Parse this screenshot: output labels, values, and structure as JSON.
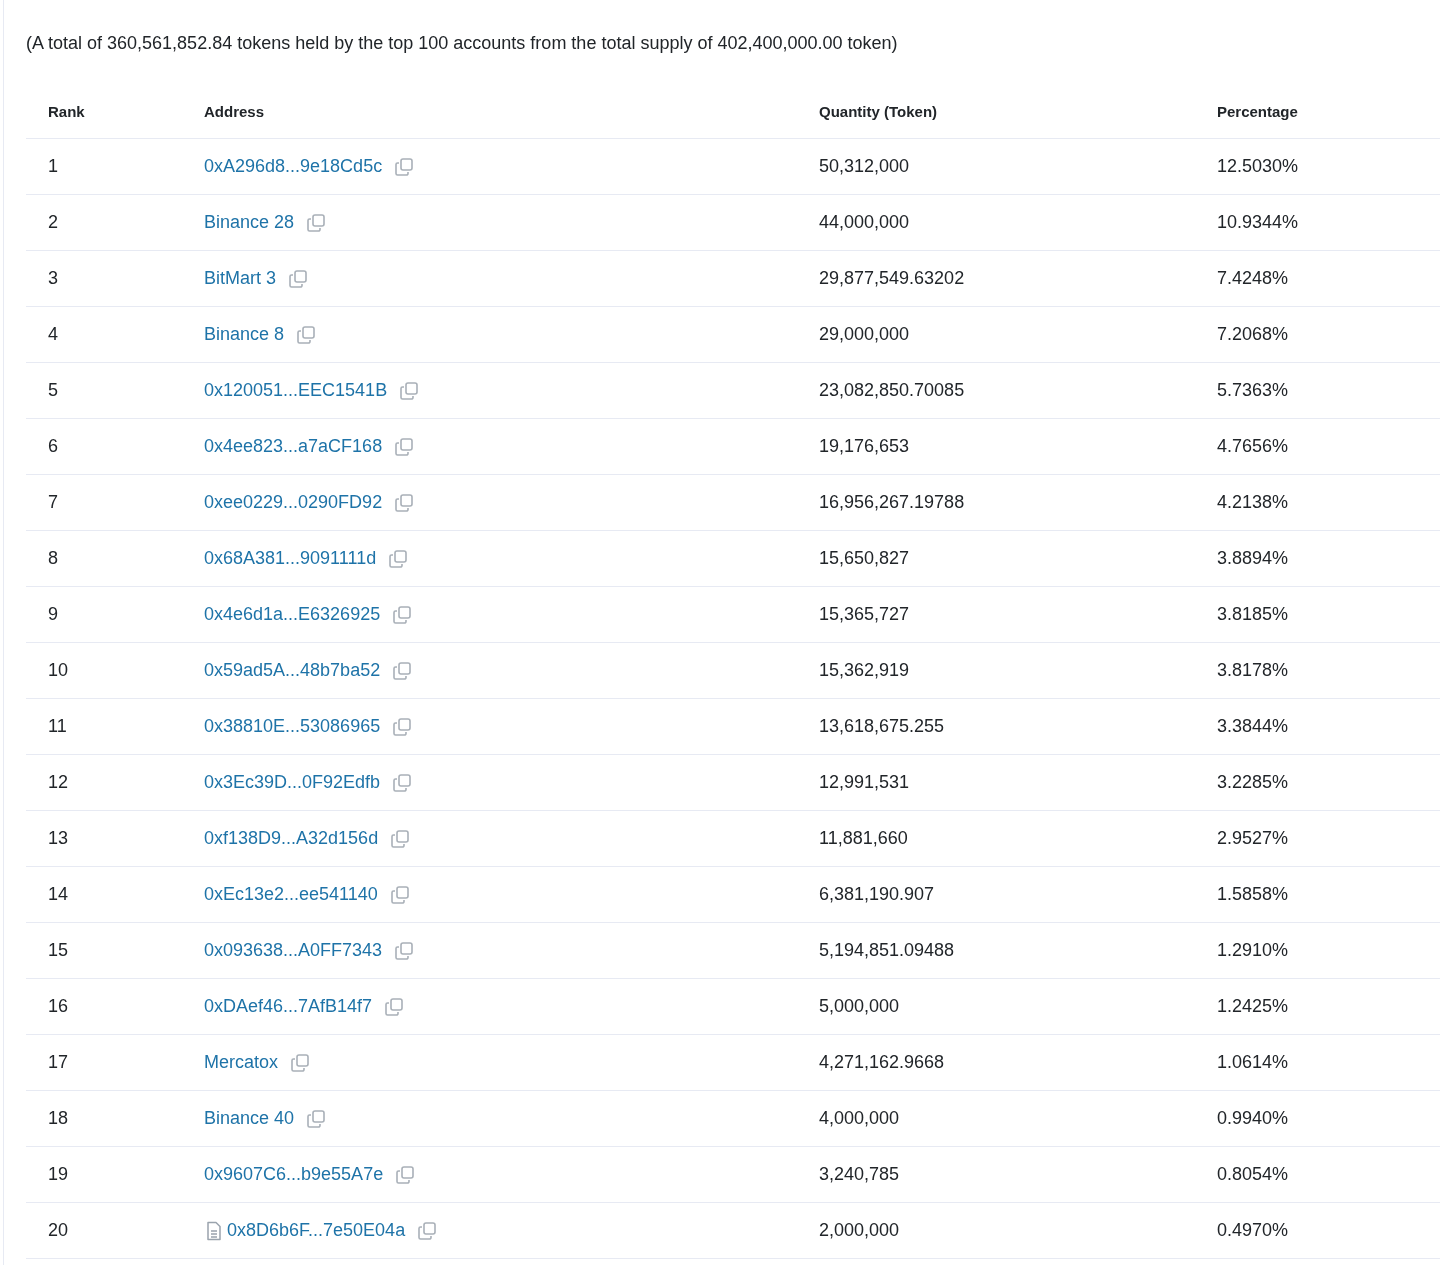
{
  "summary": "(A total of 360,561,852.84 tokens held by the top 100 accounts from the total supply of 402,400,000.00 token)",
  "table": {
    "columns": [
      "Rank",
      "Address",
      "Quantity (Token)",
      "Percentage"
    ],
    "rows": [
      {
        "rank": "1",
        "address": "0xA296d8...9e18Cd5c",
        "contract": false,
        "quantity": "50,312,000",
        "percentage": "12.5030%"
      },
      {
        "rank": "2",
        "address": "Binance 28",
        "contract": false,
        "quantity": "44,000,000",
        "percentage": "10.9344%"
      },
      {
        "rank": "3",
        "address": "BitMart 3",
        "contract": false,
        "quantity": "29,877,549.63202",
        "percentage": "7.4248%"
      },
      {
        "rank": "4",
        "address": "Binance 8",
        "contract": false,
        "quantity": "29,000,000",
        "percentage": "7.2068%"
      },
      {
        "rank": "5",
        "address": "0x120051...EEC1541B",
        "contract": false,
        "quantity": "23,082,850.70085",
        "percentage": "5.7363%"
      },
      {
        "rank": "6",
        "address": "0x4ee823...a7aCF168",
        "contract": false,
        "quantity": "19,176,653",
        "percentage": "4.7656%"
      },
      {
        "rank": "7",
        "address": "0xee0229...0290FD92",
        "contract": false,
        "quantity": "16,956,267.19788",
        "percentage": "4.2138%"
      },
      {
        "rank": "8",
        "address": "0x68A381...9091111d",
        "contract": false,
        "quantity": "15,650,827",
        "percentage": "3.8894%"
      },
      {
        "rank": "9",
        "address": "0x4e6d1a...E6326925",
        "contract": false,
        "quantity": "15,365,727",
        "percentage": "3.8185%"
      },
      {
        "rank": "10",
        "address": "0x59ad5A...48b7ba52",
        "contract": false,
        "quantity": "15,362,919",
        "percentage": "3.8178%"
      },
      {
        "rank": "11",
        "address": "0x38810E...53086965",
        "contract": false,
        "quantity": "13,618,675.255",
        "percentage": "3.3844%"
      },
      {
        "rank": "12",
        "address": "0x3Ec39D...0F92Edfb",
        "contract": false,
        "quantity": "12,991,531",
        "percentage": "3.2285%"
      },
      {
        "rank": "13",
        "address": "0xf138D9...A32d156d",
        "contract": false,
        "quantity": "11,881,660",
        "percentage": "2.9527%"
      },
      {
        "rank": "14",
        "address": "0xEc13e2...ee541140",
        "contract": false,
        "quantity": "6,381,190.907",
        "percentage": "1.5858%"
      },
      {
        "rank": "15",
        "address": "0x093638...A0FF7343",
        "contract": false,
        "quantity": "5,194,851.09488",
        "percentage": "1.2910%"
      },
      {
        "rank": "16",
        "address": "0xDAef46...7AfB14f7",
        "contract": false,
        "quantity": "5,000,000",
        "percentage": "1.2425%"
      },
      {
        "rank": "17",
        "address": "Mercatox",
        "contract": false,
        "quantity": "4,271,162.9668",
        "percentage": "1.0614%"
      },
      {
        "rank": "18",
        "address": "Binance 40",
        "contract": false,
        "quantity": "4,000,000",
        "percentage": "0.9940%"
      },
      {
        "rank": "19",
        "address": "0x9607C6...b9e55A7e",
        "contract": false,
        "quantity": "3,240,785",
        "percentage": "0.8054%"
      },
      {
        "rank": "20",
        "address": "0x8D6b6F...7e50E04a",
        "contract": true,
        "quantity": "2,000,000",
        "percentage": "0.4970%"
      }
    ]
  }
}
